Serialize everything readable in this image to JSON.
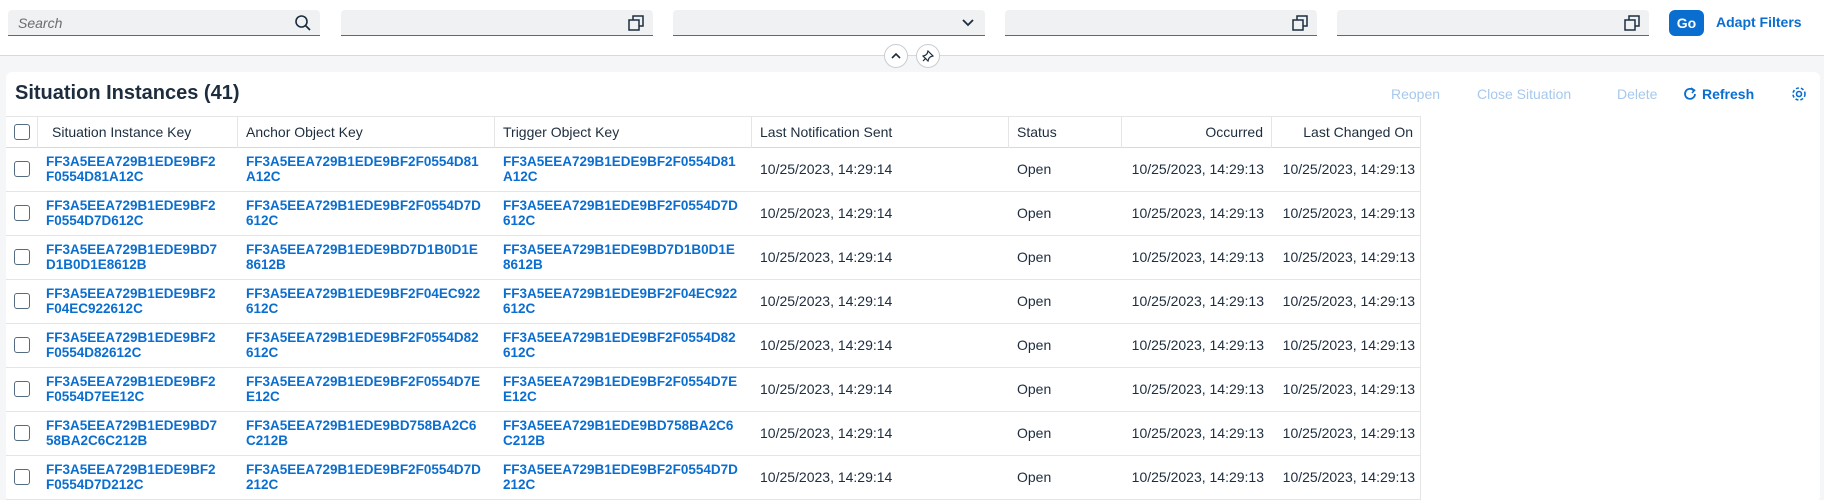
{
  "filterbar": {
    "search_placeholder": "Search",
    "go_label": "Go",
    "adapt_filters_label": "Adapt Filters"
  },
  "table": {
    "title": "Situation Instances (41)",
    "toolbar": {
      "reopen": "Reopen",
      "close_situation": "Close Situation",
      "delete": "Delete",
      "refresh": "Refresh"
    },
    "columns": {
      "situation_instance_key": "Situation Instance Key",
      "anchor_object_key": "Anchor Object Key",
      "trigger_object_key": "Trigger Object Key",
      "last_notification_sent": "Last Notification Sent",
      "status": "Status",
      "occurred": "Occurred",
      "last_changed_on": "Last Changed On"
    },
    "rows": [
      {
        "sik1": "FF3A5EEA729B1EDE9BF2",
        "sik2": "F0554D81A12C",
        "aok1": "FF3A5EEA729B1EDE9BF2F0554D81",
        "aok2": "A12C",
        "tok1": "FF3A5EEA729B1EDE9BF2F0554D81",
        "tok2": "A12C",
        "notif": "10/25/2023, 14:29:14",
        "status": "Open",
        "occurred": "10/25/2023, 14:29:13",
        "changed": "10/25/2023, 14:29:13"
      },
      {
        "sik1": "FF3A5EEA729B1EDE9BF2",
        "sik2": "F0554D7D612C",
        "aok1": "FF3A5EEA729B1EDE9BF2F0554D7D",
        "aok2": "612C",
        "tok1": "FF3A5EEA729B1EDE9BF2F0554D7D",
        "tok2": "612C",
        "notif": "10/25/2023, 14:29:14",
        "status": "Open",
        "occurred": "10/25/2023, 14:29:13",
        "changed": "10/25/2023, 14:29:13"
      },
      {
        "sik1": "FF3A5EEA729B1EDE9BD7",
        "sik2": "D1B0D1E8612B",
        "aok1": "FF3A5EEA729B1EDE9BD7D1B0D1E",
        "aok2": "8612B",
        "tok1": "FF3A5EEA729B1EDE9BD7D1B0D1E",
        "tok2": "8612B",
        "notif": "10/25/2023, 14:29:14",
        "status": "Open",
        "occurred": "10/25/2023, 14:29:13",
        "changed": "10/25/2023, 14:29:13"
      },
      {
        "sik1": "FF3A5EEA729B1EDE9BF2",
        "sik2": "F04EC922612C",
        "aok1": "FF3A5EEA729B1EDE9BF2F04EC922",
        "aok2": "612C",
        "tok1": "FF3A5EEA729B1EDE9BF2F04EC922",
        "tok2": "612C",
        "notif": "10/25/2023, 14:29:14",
        "status": "Open",
        "occurred": "10/25/2023, 14:29:13",
        "changed": "10/25/2023, 14:29:13"
      },
      {
        "sik1": "FF3A5EEA729B1EDE9BF2",
        "sik2": "F0554D82612C",
        "aok1": "FF3A5EEA729B1EDE9BF2F0554D82",
        "aok2": "612C",
        "tok1": "FF3A5EEA729B1EDE9BF2F0554D82",
        "tok2": "612C",
        "notif": "10/25/2023, 14:29:14",
        "status": "Open",
        "occurred": "10/25/2023, 14:29:13",
        "changed": "10/25/2023, 14:29:13"
      },
      {
        "sik1": "FF3A5EEA729B1EDE9BF2",
        "sik2": "F0554D7EE12C",
        "aok1": "FF3A5EEA729B1EDE9BF2F0554D7E",
        "aok2": "E12C",
        "tok1": "FF3A5EEA729B1EDE9BF2F0554D7E",
        "tok2": "E12C",
        "notif": "10/25/2023, 14:29:14",
        "status": "Open",
        "occurred": "10/25/2023, 14:29:13",
        "changed": "10/25/2023, 14:29:13"
      },
      {
        "sik1": "FF3A5EEA729B1EDE9BD7",
        "sik2": "58BA2C6C212B",
        "aok1": "FF3A5EEA729B1EDE9BD758BA2C6",
        "aok2": "C212B",
        "tok1": "FF3A5EEA729B1EDE9BD758BA2C6",
        "tok2": "C212B",
        "notif": "10/25/2023, 14:29:14",
        "status": "Open",
        "occurred": "10/25/2023, 14:29:13",
        "changed": "10/25/2023, 14:29:13"
      },
      {
        "sik1": "FF3A5EEA729B1EDE9BF2",
        "sik2": "F0554D7D212C",
        "aok1": "FF3A5EEA729B1EDE9BF2F0554D7D",
        "aok2": "212C",
        "tok1": "FF3A5EEA729B1EDE9BF2F0554D7D",
        "tok2": "212C",
        "notif": "10/25/2023, 14:29:14",
        "status": "Open",
        "occurred": "10/25/2023, 14:29:13",
        "changed": "10/25/2023, 14:29:13"
      }
    ]
  },
  "colors": {
    "accent": "#0a6ed1",
    "disabled_link": "#a6c8ed",
    "text": "#1d2d3e"
  },
  "icons": [
    "search-icon",
    "value-help-icon",
    "chevron-down-icon",
    "collapse-up-icon",
    "pin-icon",
    "refresh-icon",
    "settings-icon"
  ]
}
